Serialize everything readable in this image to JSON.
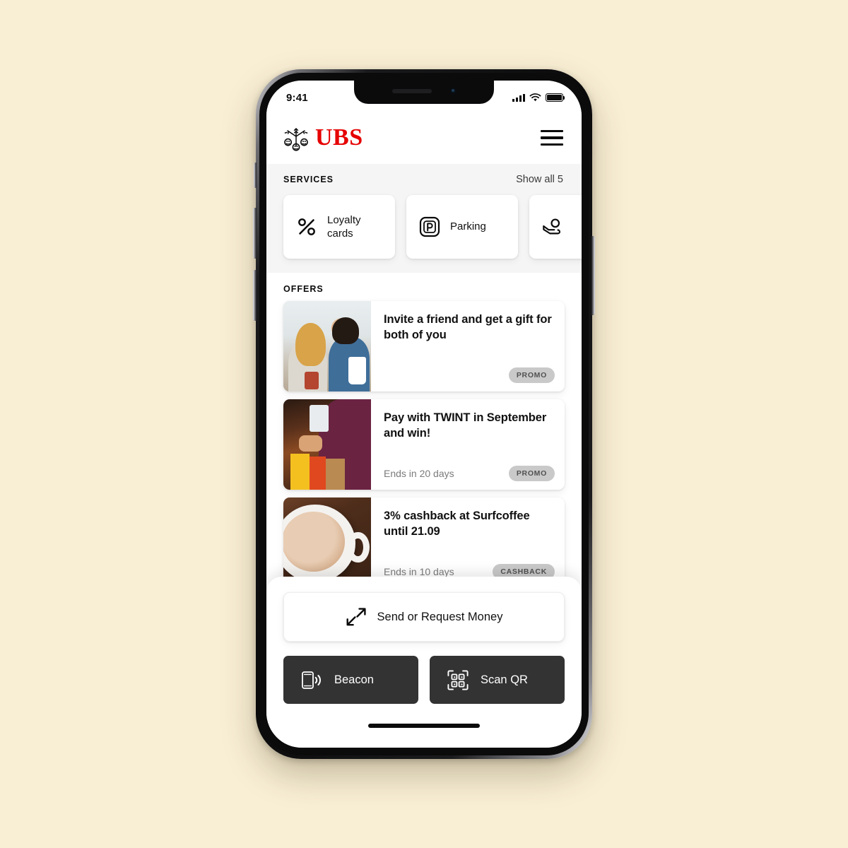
{
  "meta": {
    "background_color": "#f9efd5",
    "brand_color": "#e60000",
    "dark_button_color": "#333333"
  },
  "status_bar": {
    "time": "9:41",
    "signal_icon": "cellular-bars-icon",
    "wifi_icon": "wifi-icon",
    "battery_icon": "battery-full-icon"
  },
  "header": {
    "logo_icon": "ubs-keys-logo-icon",
    "brand": "UBS",
    "menu_icon": "hamburger-menu-icon"
  },
  "services": {
    "title": "SERVICES",
    "show_all": "Show all 5",
    "items": [
      {
        "label": "Loyalty cards",
        "icon": "percent-icon"
      },
      {
        "label": "Parking",
        "icon": "parking-p-icon"
      },
      {
        "label": "",
        "icon": "hand-holding-coin-icon"
      }
    ]
  },
  "offers": {
    "title": "OFFERS",
    "items": [
      {
        "title": "Invite a friend and get a gift for both of you",
        "ends": "",
        "badge": "PROMO",
        "image": "couple-with-phone-photo"
      },
      {
        "title": "Pay with TWINT in September and win!",
        "ends": "Ends in 20 days",
        "badge": "PROMO",
        "image": "shopper-with-bags-photo"
      },
      {
        "title": "3% cashback at Surfcoffee until 21.09",
        "ends": "Ends in 10 days",
        "badge": "CASHBACK",
        "image": "coffee-cup-photo"
      }
    ]
  },
  "bottom_sheet": {
    "send_request": {
      "label": "Send or Request Money",
      "icon": "send-receive-arrows-icon"
    },
    "beacon": {
      "label": "Beacon",
      "icon": "phone-beacon-icon"
    },
    "scan_qr": {
      "label": "Scan QR",
      "icon": "qr-code-icon"
    }
  }
}
